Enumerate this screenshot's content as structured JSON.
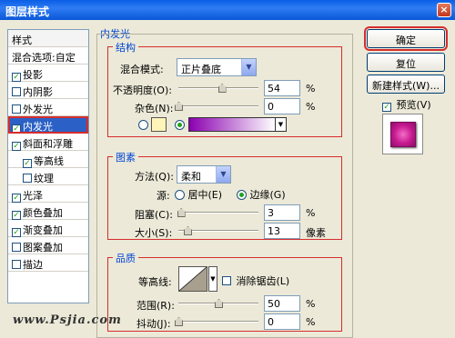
{
  "window": {
    "title": "图层样式",
    "close": "×"
  },
  "style_list": {
    "header": "样式",
    "blend_options": "混合选项:自定",
    "items": [
      {
        "label": "投影",
        "checked": true
      },
      {
        "label": "内阴影",
        "checked": false
      },
      {
        "label": "外发光",
        "checked": false
      },
      {
        "label": "内发光",
        "checked": true,
        "selected": true
      },
      {
        "label": "斜面和浮雕",
        "checked": true
      },
      {
        "label": "等高线",
        "checked": true
      },
      {
        "label": "纹理",
        "checked": false
      },
      {
        "label": "光泽",
        "checked": true
      },
      {
        "label": "颜色叠加",
        "checked": true
      },
      {
        "label": "渐变叠加",
        "checked": true
      },
      {
        "label": "图案叠加",
        "checked": false
      },
      {
        "label": "描边",
        "checked": false
      }
    ]
  },
  "panel": {
    "title": "内发光",
    "structure": {
      "legend": "结构",
      "blend_mode_label": "混合模式:",
      "blend_mode_value": "正片叠底",
      "opacity_label": "不透明度(O):",
      "opacity_value": "54",
      "opacity_fraction": 0.54,
      "noise_label": "杂色(N):",
      "noise_value": "0",
      "noise_fraction": 0.0,
      "percent": "%",
      "solid_color": "#fff5b8",
      "gradient_from": "#8a00b0",
      "gradient_to": "#ffffff"
    },
    "elements": {
      "legend": "图素",
      "method_label": "方法(Q):",
      "method_value": "柔和",
      "source_label": "源:",
      "source_center": "居中(E)",
      "source_edge": "边缘(G)",
      "choke_label": "阻塞(C):",
      "choke_value": "3",
      "choke_fraction": 0.03,
      "size_label": "大小(S):",
      "size_value": "13",
      "size_unit": "像素",
      "percent": "%"
    },
    "quality": {
      "legend": "品质",
      "contour_label": "等高线:",
      "antialias_label": "消除锯齿(L)",
      "range_label": "范围(R):",
      "range_value": "50",
      "range_fraction": 0.5,
      "jitter_label": "抖动(J):",
      "jitter_value": "0",
      "jitter_fraction": 0.0,
      "percent": "%"
    }
  },
  "buttons": {
    "ok": "确定",
    "reset": "复位",
    "new_style": "新建样式(W)...",
    "preview": "预览(V)"
  },
  "watermark": "www.Psjia.com",
  "colors": {
    "accent": "#0046d5",
    "highlight": "#d62d2d",
    "selection": "#2b61c6"
  }
}
